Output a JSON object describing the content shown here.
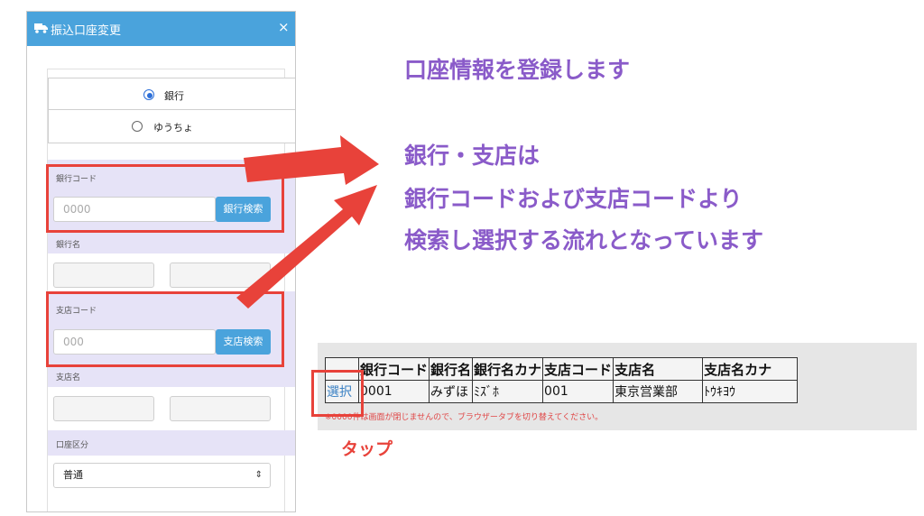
{
  "modal": {
    "title": "振込口座変更",
    "close_symbol": "×",
    "bank_type_options": [
      {
        "label": "銀行",
        "selected": true
      },
      {
        "label": "ゆうちょ",
        "selected": false
      }
    ],
    "bank_code": {
      "label": "銀行コード",
      "placeholder": "0000",
      "search_button": "銀行検索"
    },
    "bank_name": {
      "label": "銀行名"
    },
    "branch_code": {
      "label": "支店コード",
      "placeholder": "000",
      "search_button": "支店検索"
    },
    "branch_name": {
      "label": "支店名"
    },
    "account_type": {
      "label": "口座区分",
      "value": "普通"
    }
  },
  "annotation": {
    "heading": "口座情報を登録します",
    "lines": [
      "銀行・支店は",
      "銀行コードおよび支店コードより",
      "検索し選択する流れとなっています"
    ],
    "tap": "タップ"
  },
  "results": {
    "headers": [
      "",
      "銀行コード",
      "銀行名",
      "銀行名カナ",
      "支店コード",
      "支店名",
      "支店名カナ"
    ],
    "row": [
      "選択",
      "0001",
      "みずほ",
      "ﾐｽﾞﾎ",
      "001",
      "東京営業部",
      "ﾄｳｷﾖｳ"
    ],
    "note": "※0000件は画面が閉じませんので、ブラウザータブを切り替えてください。"
  },
  "colors": {
    "accent": "#4aa3dc",
    "highlight": "#e8423a",
    "annotation_text": "#8a5bc9"
  }
}
